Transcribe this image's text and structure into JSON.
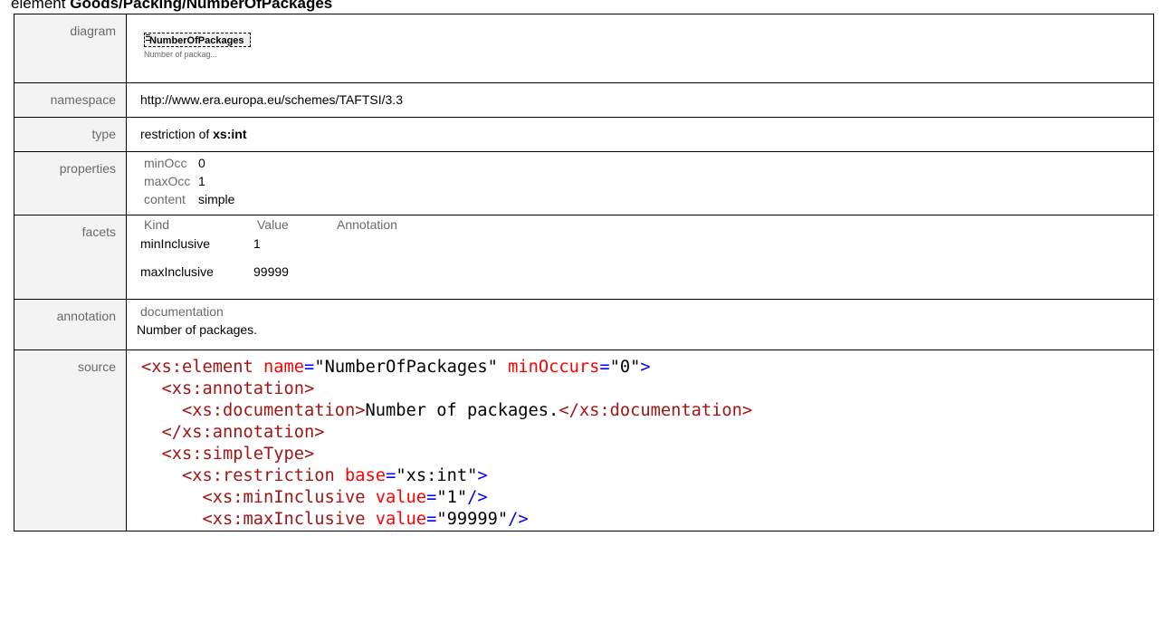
{
  "title": {
    "prefix": "element",
    "path": "Goods/Packing/NumberOfPackages"
  },
  "labels": {
    "diagram": "diagram",
    "namespace": "namespace",
    "type": "type",
    "properties": "properties",
    "facets": "facets",
    "annotation": "annotation",
    "source": "source"
  },
  "diagram": {
    "element_name": "NumberOfPackages",
    "caption": "Number of packag..."
  },
  "namespace": "http://www.era.europa.eu/schemes/TAFTSI/3.3",
  "type": {
    "prefix": "restriction of",
    "base": "xs:int"
  },
  "properties": [
    {
      "key": "minOcc",
      "value": "0"
    },
    {
      "key": "maxOcc",
      "value": "1"
    },
    {
      "key": "content",
      "value": "simple"
    }
  ],
  "facets": {
    "headers": [
      "Kind",
      "Value",
      "Annotation"
    ],
    "rows": [
      {
        "kind": "minInclusive",
        "value": "1"
      },
      {
        "kind": "maxInclusive",
        "value": "99999"
      }
    ]
  },
  "annotation": {
    "heading": "documentation",
    "text": "Number of packages."
  },
  "source": {
    "l1_tag": "<xs:element",
    "l1_a1": "name",
    "l1_v1": "\"NumberOfPackages\"",
    "l1_a2": "minOccurs",
    "l1_v2": "\"0\"",
    "l1_end": ">",
    "l2": "<xs:annotation>",
    "l3_open": "<xs:documentation>",
    "l3_text": "Number of packages.",
    "l3_close": "</xs:documentation>",
    "l4": "</xs:annotation>",
    "l5": "<xs:simpleType>",
    "l6_tag": "<xs:restriction",
    "l6_a": "base",
    "l6_v": "\"xs:int\"",
    "l6_end": ">",
    "l7_tag": "<xs:minInclusive",
    "l7_a": "value",
    "l7_v": "\"1\"",
    "l7_end": "/>",
    "l8_tag": "<xs:maxInclusive",
    "l8_a": "value",
    "l8_v": "\"99999\"",
    "l8_end": "/>"
  }
}
